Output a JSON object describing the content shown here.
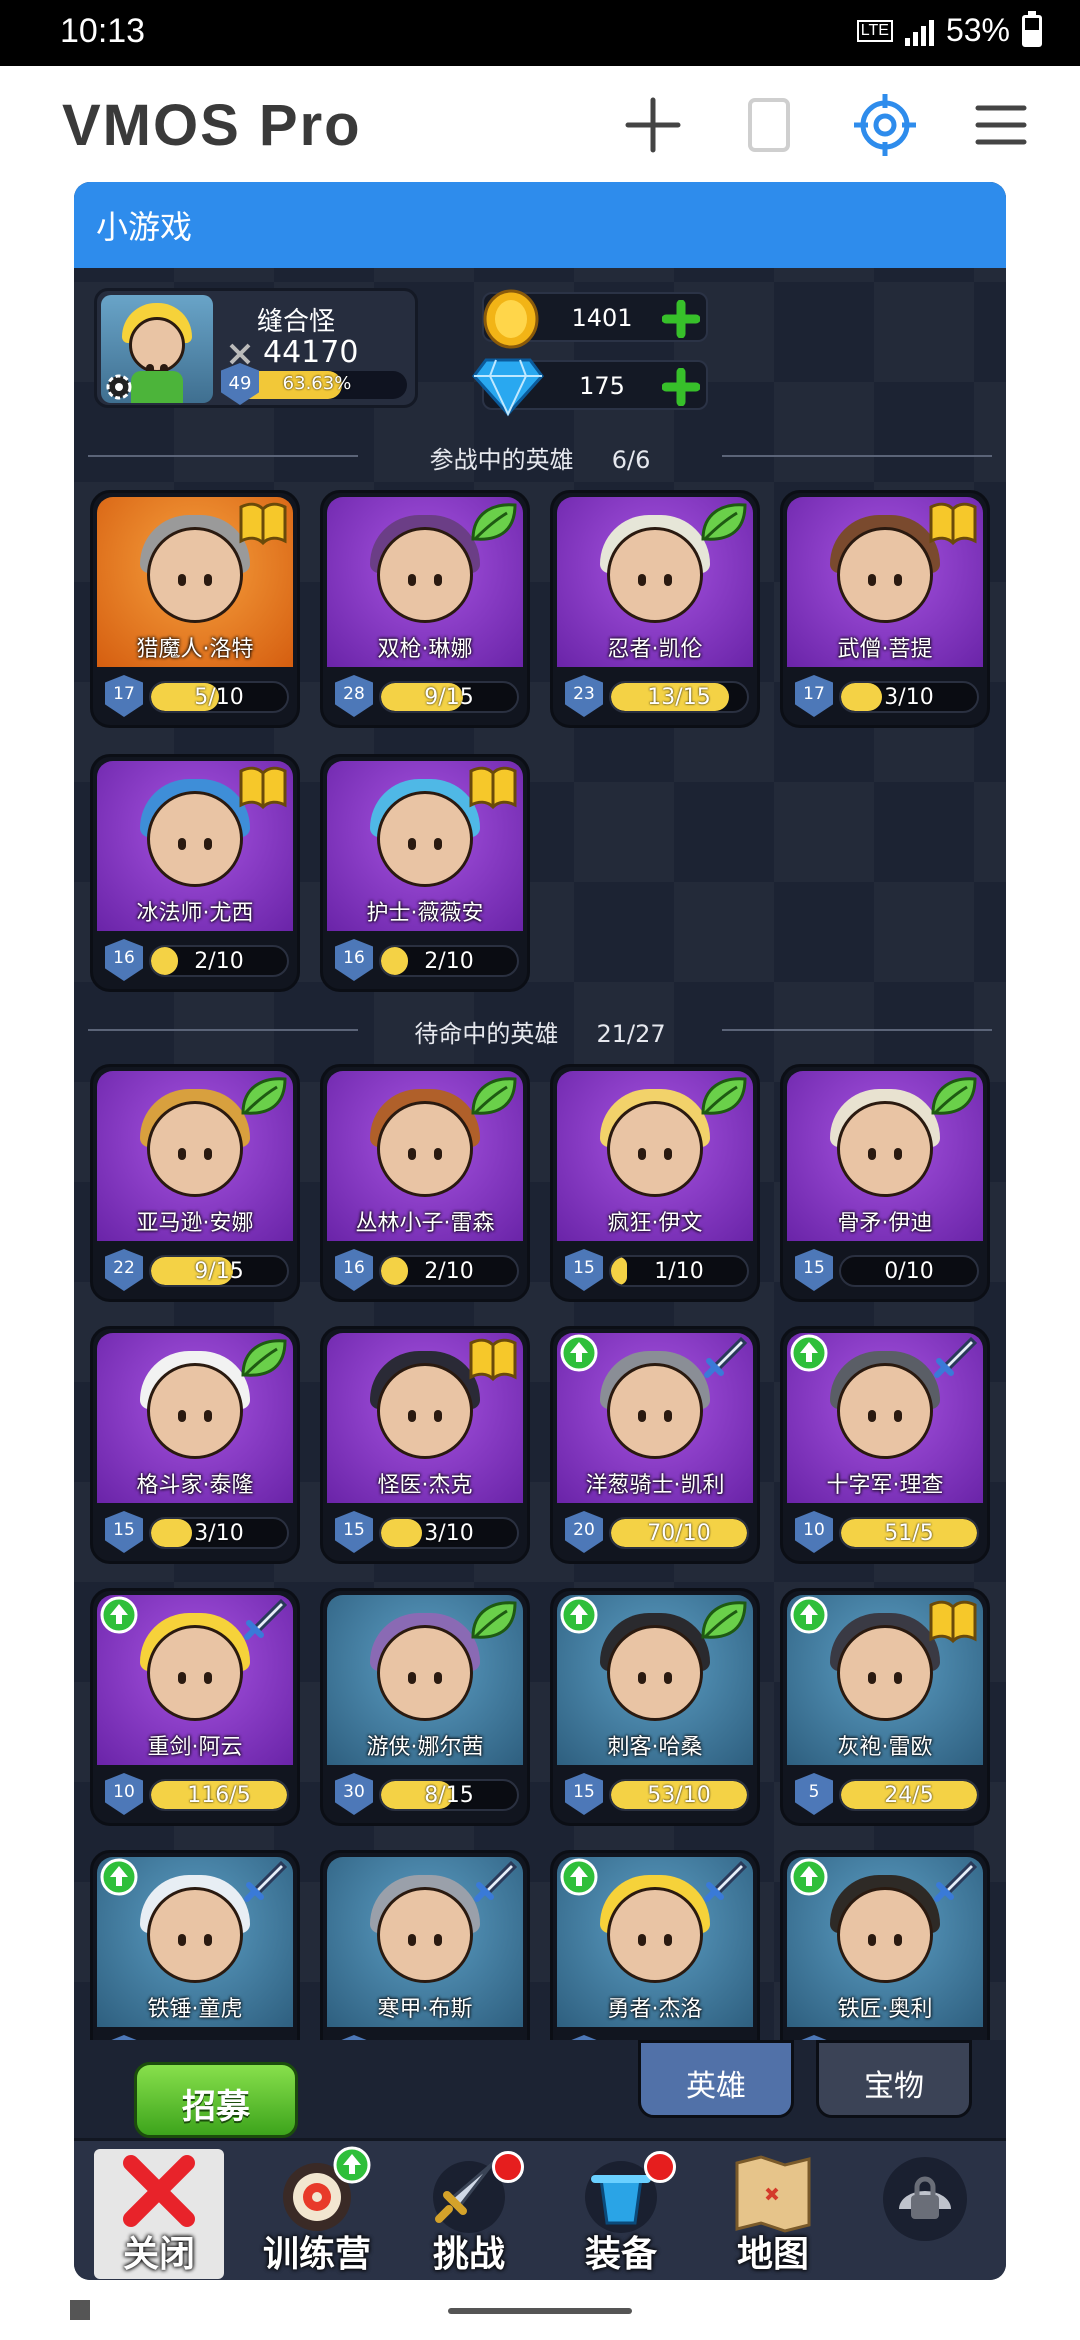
{
  "status": {
    "time": "10:13",
    "network": "LTE",
    "battery": "53%",
    "battery_level": 0.53
  },
  "app": {
    "title": "VMOS  Pro"
  },
  "panel": {
    "title": "小游戏"
  },
  "player": {
    "name": "缝合怪",
    "power": "44170",
    "level": "49",
    "exp_text": "63.63%",
    "exp_fraction": 0.6363
  },
  "resources": {
    "gold": "1401",
    "gems": "175"
  },
  "sections": {
    "active": {
      "label": "参战中的英雄",
      "count": "6/6"
    },
    "standby": {
      "label": "待命中的英雄",
      "count": "21/27"
    }
  },
  "active_heroes": [
    {
      "name": "猎魔人·洛特",
      "level": "17",
      "shards": "5/10",
      "progress": 0.5,
      "bg": "orange",
      "class": "book",
      "hair": "#9a9a9a"
    },
    {
      "name": "双枪·琳娜",
      "level": "28",
      "shards": "9/15",
      "progress": 0.6,
      "bg": "purple",
      "class": "leaf",
      "hair": "#6b3e86"
    },
    {
      "name": "忍者·凯伦",
      "level": "23",
      "shards": "13/15",
      "progress": 0.87,
      "bg": "purple",
      "class": "leaf",
      "hair": "#e6e6d8"
    },
    {
      "name": "武僧·菩提",
      "level": "17",
      "shards": "3/10",
      "progress": 0.3,
      "bg": "purple",
      "class": "book",
      "hair": "#7a4a2e"
    },
    {
      "name": "冰法师·尤西",
      "level": "16",
      "shards": "2/10",
      "progress": 0.2,
      "bg": "purple",
      "class": "book",
      "hair": "#3e8ed8"
    },
    {
      "name": "护士·薇薇安",
      "level": "16",
      "shards": "2/10",
      "progress": 0.2,
      "bg": "purple",
      "class": "book",
      "hair": "#4fb8e6"
    }
  ],
  "standby_heroes": [
    {
      "name": "亚马逊·安娜",
      "level": "22",
      "shards": "9/15",
      "progress": 0.6,
      "bg": "purple",
      "class": "leaf",
      "hair": "#d8a03e"
    },
    {
      "name": "丛林小子·雷森",
      "level": "16",
      "shards": "2/10",
      "progress": 0.2,
      "bg": "purple",
      "class": "leaf",
      "hair": "#b0602a"
    },
    {
      "name": "疯狂·伊文",
      "level": "15",
      "shards": "1/10",
      "progress": 0.1,
      "bg": "purple",
      "class": "leaf",
      "hair": "#f2d26a"
    },
    {
      "name": "骨矛·伊迪",
      "level": "15",
      "shards": "0/10",
      "progress": 0.0,
      "bg": "purple",
      "class": "leaf",
      "hair": "#e8e2d0"
    },
    {
      "name": "格斗家·泰隆",
      "level": "15",
      "shards": "3/10",
      "progress": 0.3,
      "bg": "purple",
      "class": "leaf",
      "hair": "#f2f2f2"
    },
    {
      "name": "怪医·杰克",
      "level": "15",
      "shards": "3/10",
      "progress": 0.3,
      "bg": "purple",
      "class": "book",
      "hair": "#2a2a36"
    },
    {
      "name": "洋葱骑士·凯利",
      "level": "20",
      "shards": "70/10",
      "progress": 1.0,
      "bg": "purple",
      "class": "sword",
      "upgrade": true,
      "hair": "#8a8e96"
    },
    {
      "name": "十字军·理查",
      "level": "10",
      "shards": "51/5",
      "progress": 1.0,
      "bg": "purple",
      "class": "sword",
      "upgrade": true,
      "hair": "#5a5e66"
    },
    {
      "name": "重剑·阿云",
      "level": "10",
      "shards": "116/5",
      "progress": 1.0,
      "bg": "purple",
      "class": "sword",
      "upgrade": true,
      "hair": "#f6d23a"
    },
    {
      "name": "游侠·娜尔茜",
      "level": "30",
      "shards": "8/15",
      "progress": 0.53,
      "bg": "blue",
      "class": "leaf",
      "hair": "#8a6ab4"
    },
    {
      "name": "刺客·哈桑",
      "level": "15",
      "shards": "53/10",
      "progress": 1.0,
      "bg": "blue",
      "class": "leaf",
      "upgrade": true,
      "hair": "#2a2a2e"
    },
    {
      "name": "灰袍·雷欧",
      "level": "5",
      "shards": "24/5",
      "progress": 1.0,
      "bg": "blue",
      "class": "book",
      "upgrade": true,
      "hair": "#3a3a44"
    },
    {
      "name": "铁锤·童虎",
      "level": "",
      "shards": "",
      "progress": 0,
      "bg": "blue",
      "class": "sword",
      "upgrade": true,
      "hair": "#e8eef4"
    },
    {
      "name": "寒甲·布斯",
      "level": "",
      "shards": "",
      "progress": 0,
      "bg": "blue",
      "class": "sword",
      "hair": "#9aa0aa"
    },
    {
      "name": "勇者·杰洛",
      "level": "",
      "shards": "",
      "progress": 0,
      "bg": "blue",
      "class": "sword",
      "upgrade": true,
      "hair": "#f6d23a"
    },
    {
      "name": "铁匠·奥利",
      "level": "",
      "shards": "",
      "progress": 0,
      "bg": "blue",
      "class": "sword",
      "upgrade": true,
      "hair": "#2e2a26"
    }
  ],
  "bottom": {
    "recruit": "招募",
    "tab_heroes": "英雄",
    "tab_treasure": "宝物"
  },
  "nav": {
    "close": "关闭",
    "training": "训练营",
    "challenge": "挑战",
    "equipment": "装备",
    "map": "地图"
  }
}
